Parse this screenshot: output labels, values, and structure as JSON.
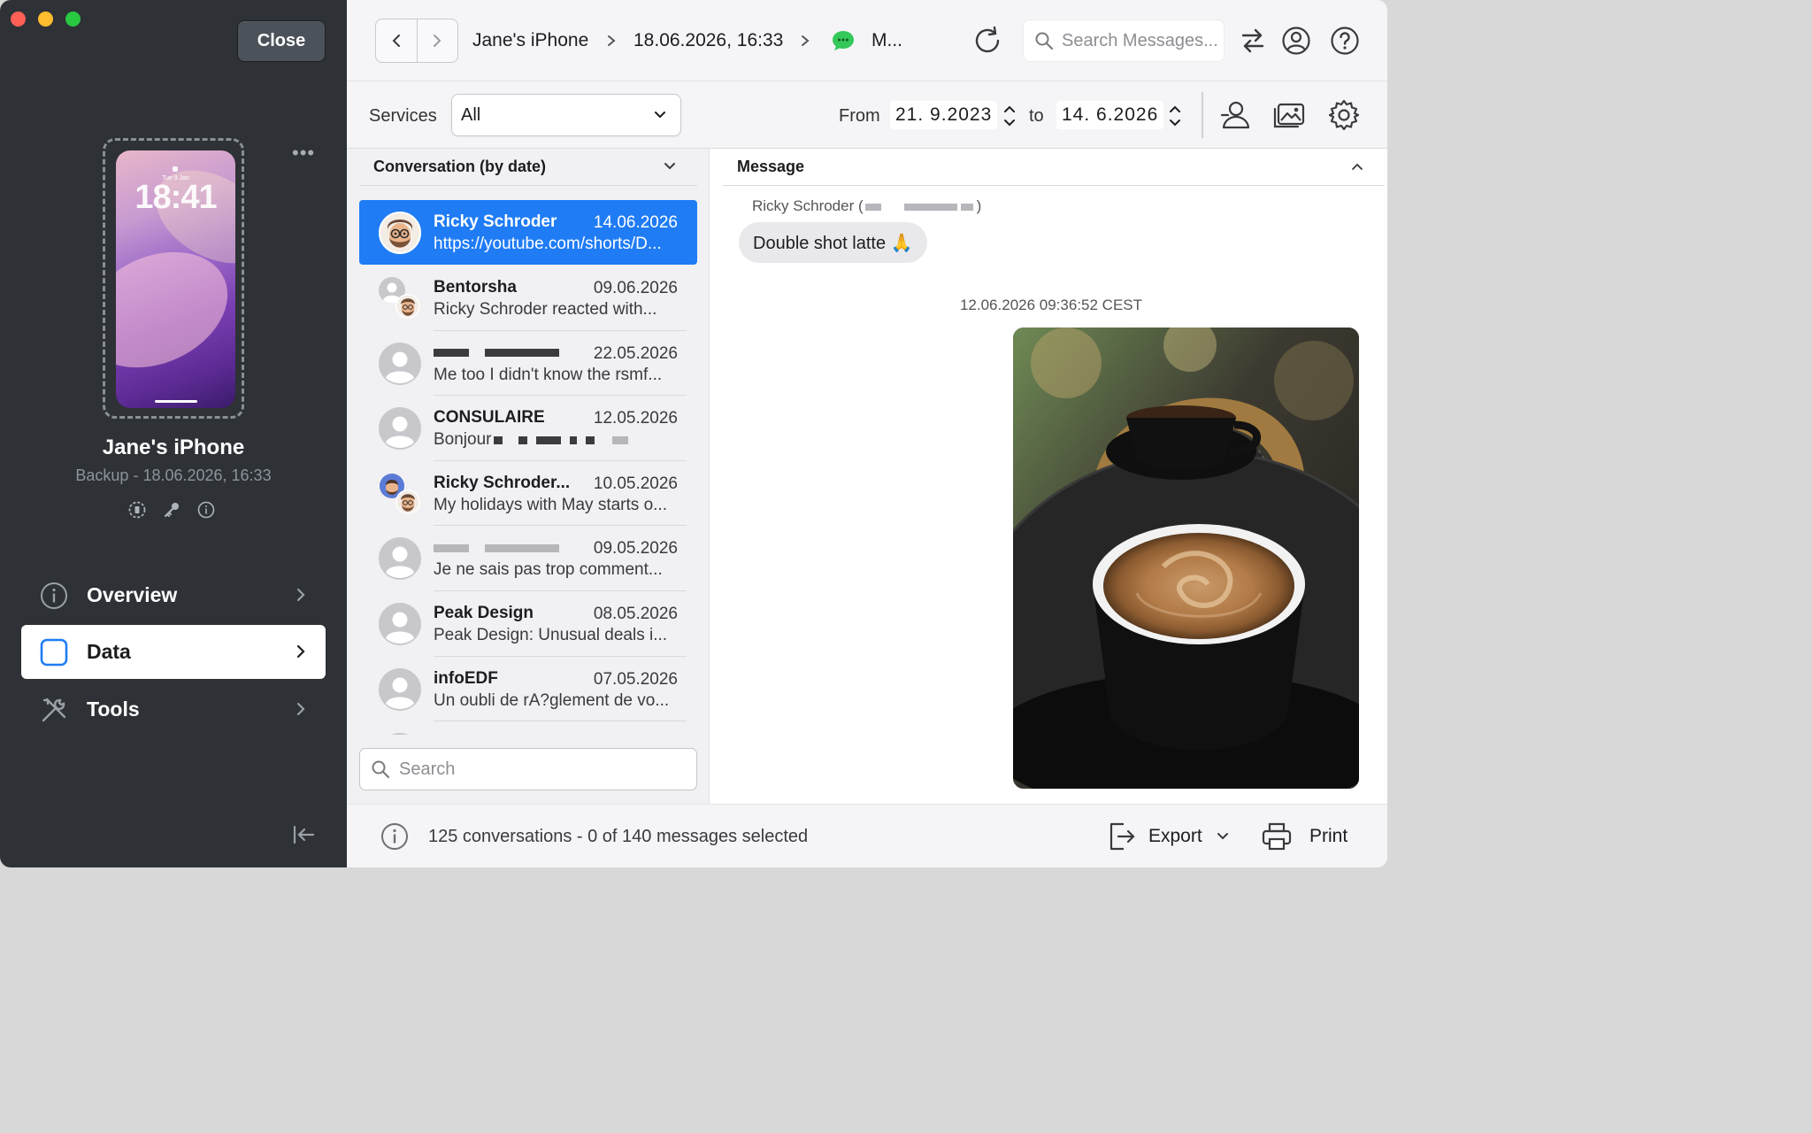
{
  "sidebar": {
    "close_label": "Close",
    "phone": {
      "date": "Tue 9 Jan",
      "time": "18:41"
    },
    "device_name": "Jane's iPhone",
    "backup_info": "Backup - 18.06.2026, 16:33",
    "nav": [
      {
        "label": "Overview",
        "icon": "info-icon"
      },
      {
        "label": "Data",
        "icon": "data-square-icon",
        "active": true
      },
      {
        "label": "Tools",
        "icon": "tools-icon"
      }
    ]
  },
  "toolbar": {
    "breadcrumb": [
      "Jane's iPhone",
      "18.06.2026, 16:33",
      "M..."
    ],
    "search_placeholder": "Search Messages..."
  },
  "filters": {
    "services_label": "Services",
    "services_value": "All",
    "from_label": "From",
    "from_date": "21. 9.2023",
    "to_label": "to",
    "to_date": "14. 6.2026"
  },
  "conversations": {
    "header": "Conversation (by date)",
    "items": [
      {
        "name": "Ricky Schroder",
        "date": "14.06.2026",
        "preview": "https://youtube.com/shorts/D...",
        "selected": true
      },
      {
        "name": "Bentorsha",
        "date": "09.06.2026",
        "preview": "Ricky Schroder reacted with..."
      },
      {
        "name": "",
        "date": "22.05.2026",
        "preview": "Me too I didn't know the rsmf..."
      },
      {
        "name": "CONSULAIRE",
        "date": "12.05.2026",
        "preview": "Bonjour"
      },
      {
        "name": "Ricky Schroder...",
        "date": "10.05.2026",
        "preview": "My holidays with May starts o..."
      },
      {
        "name": "",
        "date": "09.05.2026",
        "preview": "Je ne sais pas trop comment..."
      },
      {
        "name": "Peak Design",
        "date": "08.05.2026",
        "preview": "Peak Design: Unusual deals i..."
      },
      {
        "name": "infoEDF",
        "date": "07.05.2026",
        "preview": "Un oubli de rA?glement de vo..."
      }
    ],
    "search_placeholder": "Search"
  },
  "message": {
    "header": "Message",
    "sender": "Ricky Schroder (",
    "sender_close": ")",
    "bubble_text": "Double shot latte 🙏",
    "timestamp": "12.06.2026 09:36:52 CEST"
  },
  "status": {
    "text": "125 conversations - 0 of 140 messages selected",
    "export_label": "Export",
    "print_label": "Print"
  },
  "colors": {
    "accent": "#1f7cf5",
    "sidebar_bg": "#2e3136",
    "imessage_green": "#34c759"
  }
}
